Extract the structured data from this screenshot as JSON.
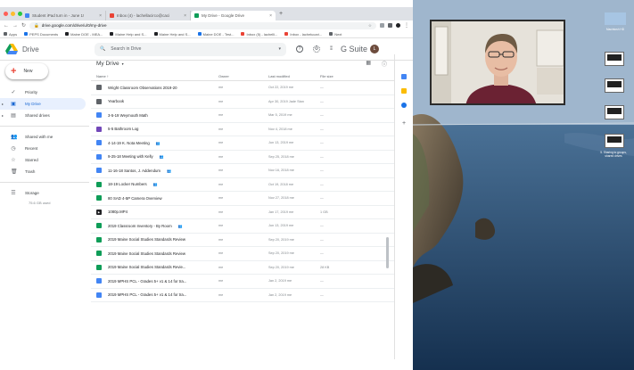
{
  "browser": {
    "tabs": [
      {
        "label": "Student iPad turn in - June 1!",
        "color": "#4285f4",
        "active": false
      },
      {
        "label": "Inbox (4) - lachellacirco@caci",
        "color": "#ea4335",
        "active": false
      },
      {
        "label": "My Drive - Google Drive",
        "color": "#0f9d58",
        "active": true
      }
    ],
    "url": "drive.google.com/drive/u/0/my-drive",
    "bookmarks": [
      {
        "label": "Apps",
        "color": "#5f6368"
      },
      {
        "label": "PEPS Documents",
        "color": "#1a73e8"
      },
      {
        "label": "Maine DOE - MEA...",
        "color": "#202124"
      },
      {
        "label": "Maine Help and S...",
        "color": "#202124"
      },
      {
        "label": "Maine Help and S...",
        "color": "#202124"
      },
      {
        "label": "Maine DOE - Test...",
        "color": "#1a73e8"
      },
      {
        "label": "Inbox (5) - lachelli...",
        "color": "#ea4335"
      },
      {
        "label": "Inbox - lachelucari...",
        "color": "#ea4335"
      },
      {
        "label": "Next",
        "color": "#5f6368"
      }
    ]
  },
  "header": {
    "app_name": "Drive",
    "search_placeholder": "Search in Drive",
    "suite_label": "G Suite",
    "avatar_letter": "L"
  },
  "sidebar": {
    "new_label": "New",
    "items": [
      {
        "label": "Priority",
        "icon": "✓"
      },
      {
        "label": "My Drive",
        "icon": "▣",
        "active": true
      },
      {
        "label": "Shared drives",
        "icon": "▤"
      },
      {
        "label": "Shared with me",
        "icon": "👥"
      },
      {
        "label": "Recent",
        "icon": "◷"
      },
      {
        "label": "Starred",
        "icon": "☆"
      },
      {
        "label": "Trash",
        "icon": "🗑"
      }
    ],
    "storage_label": "Storage",
    "storage_used": "75.6 GB used"
  },
  "main": {
    "title": "My Drive",
    "columns": {
      "name": "Name",
      "owner": "Owner",
      "modified": "Last modified",
      "size": "File size"
    },
    "files": [
      {
        "type": "folder",
        "name": "Wright Classroom Observations 2019-20",
        "owner": "me",
        "modified": "Oct 22, 2019 me",
        "size": "—",
        "shared": false
      },
      {
        "type": "folder",
        "name": "Yearbook",
        "owner": "me",
        "modified": "Apr 30, 2019 Jade Stan",
        "size": "—",
        "shared": false
      },
      {
        "type": "docs",
        "name": "3-5-19 Weymouth Math",
        "owner": "me",
        "modified": "Mar 5, 2019 me",
        "size": "—",
        "shared": false
      },
      {
        "type": "forms",
        "name": "5-5 Bathroom Log",
        "owner": "me",
        "modified": "Nov 4, 2018 me",
        "size": "—",
        "shared": false
      },
      {
        "type": "docs",
        "name": "4-14-19 K. Nota Meeting",
        "owner": "me",
        "modified": "Jun 13, 2019 me",
        "size": "—",
        "shared": true
      },
      {
        "type": "docs",
        "name": "9-25-18 Meeting with Kelly",
        "owner": "me",
        "modified": "Sep 25, 2018 me",
        "size": "—",
        "shared": true
      },
      {
        "type": "docs",
        "name": "11-16-18 Santos, J. Addendum",
        "owner": "me",
        "modified": "Nov 16, 2018 me",
        "size": "—",
        "shared": true
      },
      {
        "type": "sheets",
        "name": "18-19 Locker Numbers",
        "owner": "me",
        "modified": "Oct 19, 2018 me",
        "size": "—",
        "shared": true
      },
      {
        "type": "sheets",
        "name": "80 SAD 4-5P Camera Overview",
        "owner": "me",
        "modified": "Nov 27, 2018 me",
        "size": "—",
        "shared": false
      },
      {
        "type": "video",
        "name": "1080p.MP4",
        "owner": "me",
        "modified": "Jan 17, 2019 me",
        "size": "1 GB",
        "shared": false
      },
      {
        "type": "sheets",
        "name": "2019 Classroom Inventory - By Room",
        "owner": "me",
        "modified": "Jun 13, 2019 me",
        "size": "—",
        "shared": true
      },
      {
        "type": "sheets",
        "name": "2019 Maine Social Studies Standards Review",
        "owner": "me",
        "modified": "Sep 20, 2019 me",
        "size": "—",
        "shared": false
      },
      {
        "type": "sheets",
        "name": "2019 Maine Social Studies Standards Review",
        "owner": "me",
        "modified": "Sep 20, 2019 me",
        "size": "—",
        "shared": false
      },
      {
        "type": "sheets",
        "name": "2019 Maine Social Studies Standards Revie...",
        "owner": "me",
        "modified": "Sep 20, 2019 me",
        "size": "28 KB",
        "shared": false
      },
      {
        "type": "docs",
        "name": "2019 MPHS PCL - Grades 5+ v1 & 14 for tra...",
        "owner": "me",
        "modified": "Jan 2, 2019 me",
        "size": "—",
        "shared": false
      },
      {
        "type": "docs",
        "name": "2019 MPHS PCL - Grades 5+ v1 & 14 for tra...",
        "owner": "me",
        "modified": "Jan 2, 2019 me",
        "size": "—",
        "shared": false
      }
    ]
  },
  "desktop": {
    "icons": [
      {
        "label": "Macintosh HD"
      },
      {
        "label": ""
      },
      {
        "label": ""
      },
      {
        "label": ""
      },
      {
        "label": "5. Sharing to groups, shared drives"
      }
    ]
  }
}
